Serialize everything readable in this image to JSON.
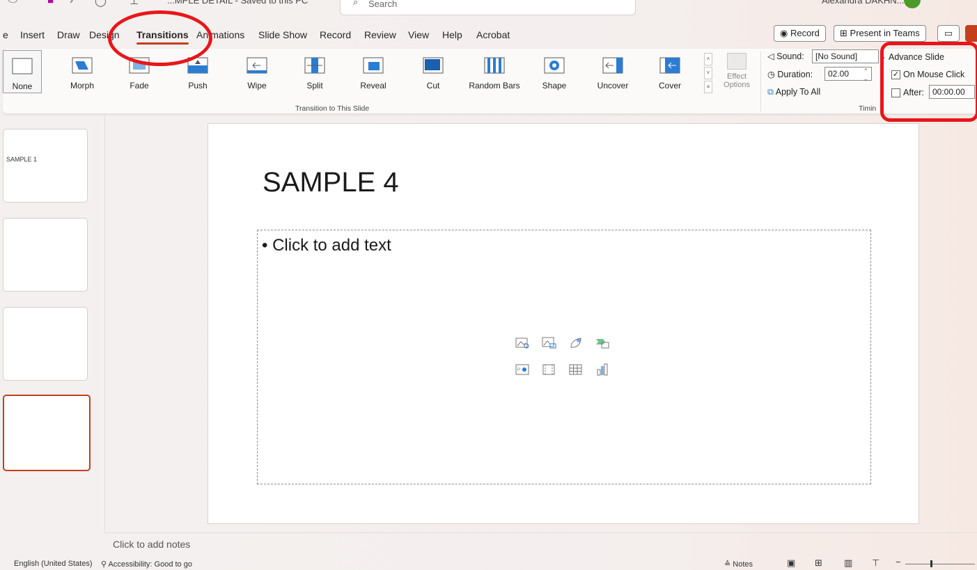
{
  "titlebar": {
    "doc_title": "...MPLE DETAIL - Saved to this PC",
    "search_placeholder": "Search",
    "user_name": "Alexandra DAKHN..."
  },
  "tabs": [
    {
      "label": "e",
      "active": false
    },
    {
      "label": "Insert",
      "active": false
    },
    {
      "label": "Draw",
      "active": false
    },
    {
      "label": "Design",
      "active": false
    },
    {
      "label": "Transitions",
      "active": true
    },
    {
      "label": "Animations",
      "active": false
    },
    {
      "label": "Slide Show",
      "active": false
    },
    {
      "label": "Record",
      "active": false
    },
    {
      "label": "Review",
      "active": false
    },
    {
      "label": "View",
      "active": false
    },
    {
      "label": "Help",
      "active": false
    },
    {
      "label": "Acrobat",
      "active": false
    }
  ],
  "top_buttons": {
    "record": "◉ Record",
    "present": "Present in Teams",
    "comment_icon": "comment-icon"
  },
  "ribbon": {
    "transitions": [
      {
        "label": "None",
        "icon": "none-transition-icon"
      },
      {
        "label": "Morph",
        "icon": "morph-transition-icon"
      },
      {
        "label": "Fade",
        "icon": "fade-transition-icon"
      },
      {
        "label": "Push",
        "icon": "push-transition-icon"
      },
      {
        "label": "Wipe",
        "icon": "wipe-transition-icon"
      },
      {
        "label": "Split",
        "icon": "split-transition-icon"
      },
      {
        "label": "Reveal",
        "icon": "reveal-transition-icon"
      },
      {
        "label": "Cut",
        "icon": "cut-transition-icon"
      },
      {
        "label": "Random Bars",
        "icon": "random-bars-transition-icon"
      },
      {
        "label": "Shape",
        "icon": "shape-transition-icon"
      },
      {
        "label": "Uncover",
        "icon": "uncover-transition-icon"
      },
      {
        "label": "Cover",
        "icon": "cover-transition-icon"
      }
    ],
    "effect_options": "Effect",
    "effect_options_line2": "Options",
    "group_label": "Transition to This Slide",
    "timing": {
      "sound_label": "Sound:",
      "sound_value": "[No Sound]",
      "duration_label": "Duration:",
      "duration_value": "02.00",
      "apply_all": "Apply To All",
      "group_label": "Timin",
      "advance_slide": "Advance Slide",
      "on_mouse_click": "On Mouse Click",
      "on_mouse_click_checked": true,
      "after_label": "After:",
      "after_checked": false,
      "after_value": "00:00.00"
    }
  },
  "thumbnails": [
    {
      "text": "SAMPLE 1",
      "active": false
    },
    {
      "text": "",
      "active": false
    },
    {
      "text": "",
      "active": false
    },
    {
      "text": "",
      "active": true
    }
  ],
  "slide": {
    "title": "SAMPLE 4",
    "bullet": "• Click to add text",
    "insert_icons": [
      "stock-images-icon",
      "pictures-icon",
      "icons-icon",
      "smartart-icon",
      "cameo-icon",
      "video-icon",
      "table-icon",
      "chart-icon"
    ]
  },
  "notes": {
    "placeholder": "Click to add notes"
  },
  "status": {
    "language": "English (United States)",
    "accessibility": "Accessibility: Good to go",
    "notes": "Notes"
  },
  "colors": {
    "accent": "#c43e1c",
    "highlight_red": "#e8161b"
  }
}
